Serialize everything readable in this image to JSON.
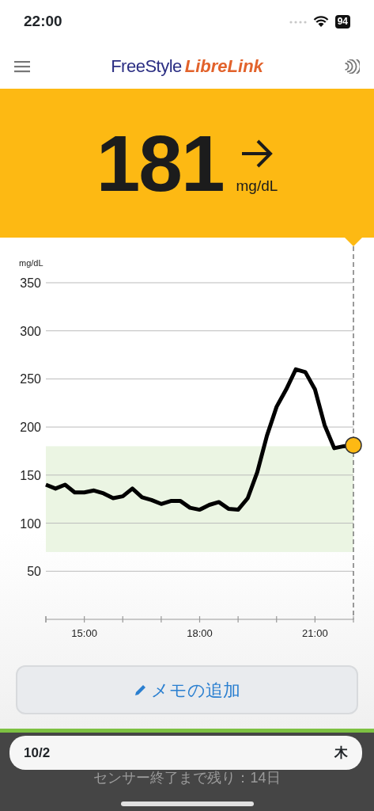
{
  "status_bar": {
    "time": "22:00",
    "battery": "94"
  },
  "header": {
    "logo_first": "FreeStyle",
    "logo_second": "LibreLink"
  },
  "reading": {
    "value": "181",
    "unit": "mg/dL"
  },
  "graph": {
    "unit_label": "mg/dL",
    "chart_data": {
      "type": "line",
      "x": [
        14,
        14.25,
        14.5,
        14.75,
        15,
        15.25,
        15.5,
        15.75,
        16,
        16.25,
        16.5,
        16.75,
        17,
        17.25,
        17.5,
        17.75,
        18,
        18.25,
        18.5,
        18.75,
        19,
        19.25,
        19.5,
        19.75,
        20,
        20.25,
        20.5,
        20.75,
        21,
        21.25,
        21.5,
        21.75,
        22
      ],
      "series": [
        {
          "color": "#000000",
          "values": [
            140,
            136,
            140,
            132,
            132,
            134,
            131,
            126,
            128,
            136,
            127,
            124,
            120,
            123,
            123,
            116,
            114,
            119,
            122,
            115,
            114,
            126,
            153,
            191,
            221,
            239,
            260,
            257,
            239,
            202,
            178,
            180,
            181
          ]
        }
      ],
      "xlim": [
        14,
        22
      ],
      "ylim": [
        0,
        350
      ],
      "xticks": [
        {
          "value": 15,
          "label": "15:00"
        },
        {
          "value": 18,
          "label": "18:00"
        },
        {
          "value": 21,
          "label": "21:00"
        }
      ],
      "yticks": [
        {
          "value": 50,
          "label": "50"
        },
        {
          "value": 100,
          "label": "100"
        },
        {
          "value": 150,
          "label": "150"
        },
        {
          "value": 200,
          "label": "200"
        },
        {
          "value": 250,
          "label": "250"
        },
        {
          "value": 300,
          "label": "300"
        },
        {
          "value": 350,
          "label": "350"
        }
      ],
      "grid": true,
      "bands": [
        {
          "axis": "y",
          "from": 70,
          "to": 180
        }
      ]
    }
  },
  "note_button": {
    "label": "メモの追加"
  },
  "date_bar": {
    "date": "10/2",
    "weekday": "木"
  },
  "sensor_notice": "センサー終了まで残り：14日"
}
